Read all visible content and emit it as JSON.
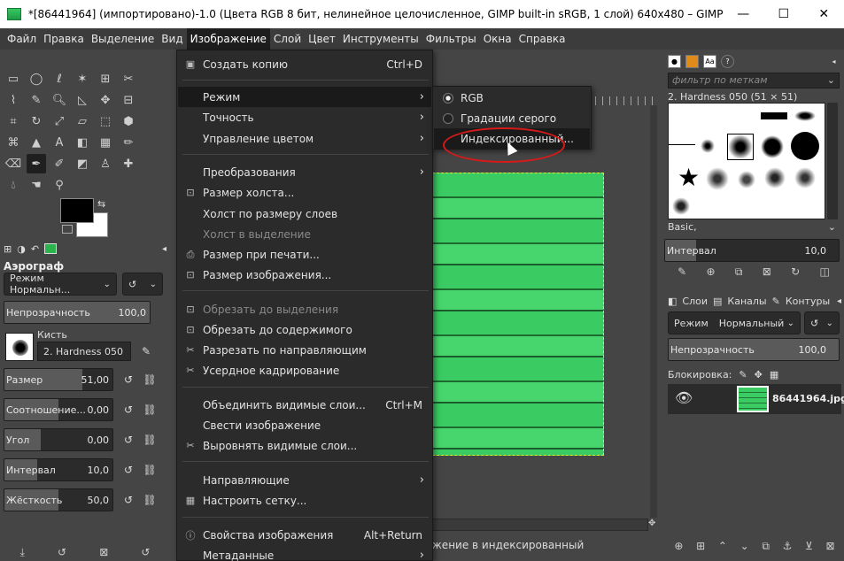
{
  "window": {
    "title": "*[86441964] (импортировано)-1.0 (Цвета RGB 8 бит, нелинейное целочисленное, GIMP built-in sRGB, 1 слой) 640x480 – GIMP",
    "minimize": "—",
    "maximize": "☐",
    "close": "✕"
  },
  "menubar": [
    "Файл",
    "Правка",
    "Выделение",
    "Вид",
    "Изображение",
    "Слой",
    "Цвет",
    "Инструменты",
    "Фильтры",
    "Окна",
    "Справка"
  ],
  "image_menu": {
    "items": [
      {
        "label": "Создать копию",
        "shortcut": "Ctrl+D",
        "icon": "▣",
        "submenu": false,
        "disabled": false
      },
      {
        "label": "Режим",
        "shortcut": "",
        "icon": "",
        "submenu": true,
        "disabled": false
      },
      {
        "label": "Точность",
        "shortcut": "",
        "icon": "",
        "submenu": true,
        "disabled": false
      },
      {
        "label": "Управление цветом",
        "shortcut": "",
        "icon": "",
        "submenu": true,
        "disabled": false
      },
      {
        "label": "Преобразования",
        "shortcut": "",
        "icon": "",
        "submenu": true,
        "disabled": false
      },
      {
        "label": "Размер холста...",
        "shortcut": "",
        "icon": "⊡",
        "submenu": false,
        "disabled": false
      },
      {
        "label": "Холст по размеру слоев",
        "shortcut": "",
        "icon": "",
        "submenu": false,
        "disabled": false
      },
      {
        "label": "Холст в выделение",
        "shortcut": "",
        "icon": "",
        "submenu": false,
        "disabled": true
      },
      {
        "label": "Размер при печати...",
        "shortcut": "",
        "icon": "⎙",
        "submenu": false,
        "disabled": false
      },
      {
        "label": "Размер изображения...",
        "shortcut": "",
        "icon": "⊡",
        "submenu": false,
        "disabled": false
      },
      {
        "label": "Обрезать до выделения",
        "shortcut": "",
        "icon": "⊡",
        "submenu": false,
        "disabled": true
      },
      {
        "label": "Обрезать до содержимого",
        "shortcut": "",
        "icon": "⊡",
        "submenu": false,
        "disabled": false
      },
      {
        "label": "Разрезать по направляющим",
        "shortcut": "",
        "icon": "✂",
        "submenu": false,
        "disabled": false
      },
      {
        "label": "Усердное кадрирование",
        "shortcut": "",
        "icon": "✂",
        "submenu": false,
        "disabled": false
      },
      {
        "label": "Объединить видимые слои...",
        "shortcut": "Ctrl+M",
        "icon": "",
        "submenu": false,
        "disabled": false
      },
      {
        "label": "Свести изображение",
        "shortcut": "",
        "icon": "",
        "submenu": false,
        "disabled": false
      },
      {
        "label": "Выровнять видимые слои...",
        "shortcut": "",
        "icon": "✂",
        "submenu": false,
        "disabled": false
      },
      {
        "label": "Направляющие",
        "shortcut": "",
        "icon": "",
        "submenu": true,
        "disabled": false
      },
      {
        "label": "Настроить сетку...",
        "shortcut": "",
        "icon": "▦",
        "submenu": false,
        "disabled": false
      },
      {
        "label": "Свойства изображения",
        "shortcut": "Alt+Return",
        "icon": "ⓘ",
        "submenu": false,
        "disabled": false
      },
      {
        "label": "Метаданные",
        "shortcut": "",
        "icon": "",
        "submenu": true,
        "disabled": false
      }
    ]
  },
  "mode_menu": {
    "items": [
      {
        "label": "RGB",
        "checked": true
      },
      {
        "label": "Градации серого",
        "checked": false
      },
      {
        "label": "Индексированный...",
        "checked": false
      }
    ]
  },
  "tool_options": {
    "title": "Аэрограф",
    "mode_value": "Режим Нормальн...",
    "opacity": {
      "label": "Непрозрачность",
      "value": "100,0",
      "fraction": 1.0
    },
    "brush_label": "Кисть",
    "brush_value": "2. Hardness 050",
    "sliders": [
      {
        "label": "Размер",
        "value": "51,00",
        "fraction": 0.72
      },
      {
        "label": "Соотношение...",
        "value": "0,00",
        "fraction": 0.5
      },
      {
        "label": "Угол",
        "value": "0,00",
        "fraction": 0.34
      },
      {
        "label": "Интервал",
        "value": "10,0",
        "fraction": 0.3
      },
      {
        "label": "Жёсткость",
        "value": "50,0",
        "fraction": 0.5
      }
    ]
  },
  "status": {
    "text": "жение в индексированный"
  },
  "brushes": {
    "filter_placeholder": "фильтр по меткам",
    "selected": "2. Hardness 050 (51 × 51)",
    "preset": "Basic,",
    "spacing_label": "Интервал",
    "spacing_value": "10,0"
  },
  "layers": {
    "tabs": [
      "Слои",
      "Каналы",
      "Контуры"
    ],
    "mode_label": "Режим",
    "mode_value": "Нормальный",
    "opacity_label": "Непрозрачность",
    "opacity_value": "100,0",
    "lock_label": "Блокировка:",
    "layer_name": "86441964.jpg"
  },
  "colors": {
    "accent_highlight": "#1a1a1a",
    "circle_annotation": "#d81919",
    "image_green": "#3acb62"
  }
}
